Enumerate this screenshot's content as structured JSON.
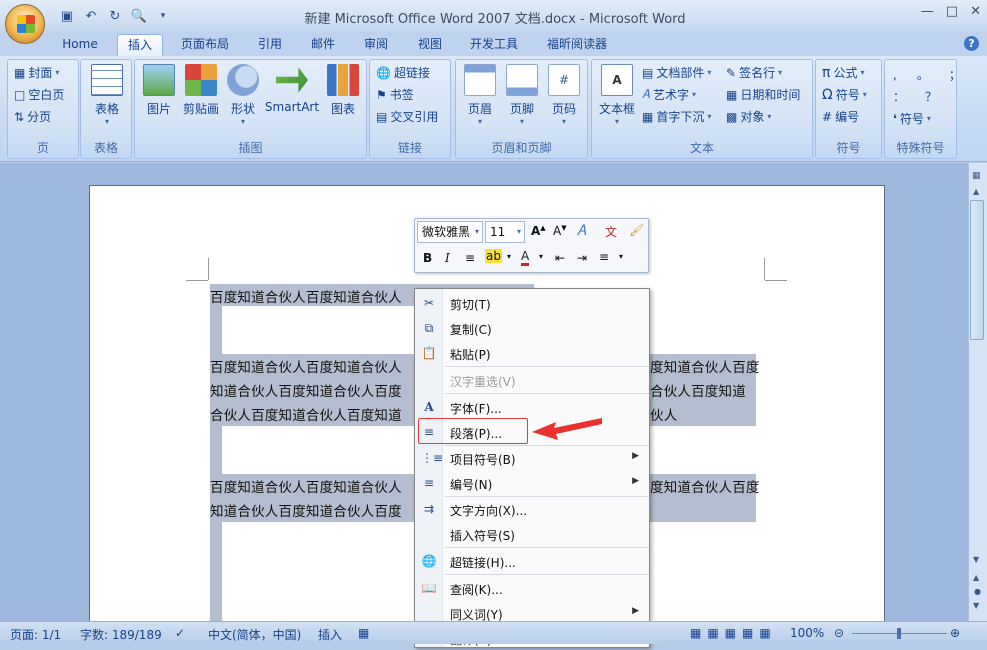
{
  "window": {
    "title": "新建 Microsoft Office Word 2007 文档.docx - Microsoft Word"
  },
  "tabs": [
    {
      "label": "Home",
      "active": false
    },
    {
      "label": "插入",
      "active": true
    },
    {
      "label": "页面布局",
      "active": false
    },
    {
      "label": "引用",
      "active": false
    },
    {
      "label": "邮件",
      "active": false
    },
    {
      "label": "审阅",
      "active": false
    },
    {
      "label": "视图",
      "active": false
    },
    {
      "label": "开发工具",
      "active": false
    },
    {
      "label": "福昕阅读器",
      "active": false
    }
  ],
  "ribbon": {
    "page_group": {
      "label": "页",
      "items": [
        "封面",
        "空白页",
        "分页"
      ]
    },
    "table_group": {
      "label": "表格",
      "button": "表格"
    },
    "illustration_group": {
      "label": "插图",
      "buttons": [
        "图片",
        "剪贴画",
        "形状",
        "SmartArt",
        "图表"
      ]
    },
    "link_group": {
      "label": "链接",
      "items": [
        "超链接",
        "书签",
        "交叉引用"
      ]
    },
    "header_group": {
      "label": "页眉和页脚",
      "buttons": [
        "页眉",
        "页脚",
        "页码"
      ]
    },
    "text_group": {
      "label": "文本",
      "big": "文本框",
      "items": [
        "文档部件",
        "艺术字",
        "首字下沉",
        "签名行",
        "日期和时间",
        "对象"
      ]
    },
    "symbol_group": {
      "label": "符号",
      "items": [
        "公式",
        "符号",
        "编号"
      ]
    },
    "special_group": {
      "label": "特殊符号",
      "chars": [
        ",",
        "。",
        "；",
        "：",
        "？"
      ],
      "item": "符号"
    }
  },
  "document": {
    "lines": [
      "百度知道合伙人百度知道合伙人",
      "百度知道合伙人百度知道合伙人",
      "知道合伙人百度知道合伙人百度",
      "合伙人百度知道合伙人百度知道",
      "百度知道合伙人百度知道合伙人",
      "知道合伙人百度知道合伙人百度"
    ],
    "right_fragments": [
      "度知道合伙人百度",
      "合伙人百度知道",
      "伙人",
      "度知道合伙人百度"
    ]
  },
  "mini_toolbar": {
    "font": "微软雅黑",
    "size": "11",
    "grow": "A",
    "shrink": "A",
    "bold": "B",
    "italic": "I",
    "font_color": "A"
  },
  "context_menu": {
    "items": [
      {
        "label": "剪切(T)",
        "icon": "scissors-icon"
      },
      {
        "label": "复制(C)",
        "icon": "copy-icon"
      },
      {
        "label": "粘贴(P)",
        "icon": "paste-icon"
      },
      {
        "label": "汉字重选(V)",
        "icon": "",
        "disabled": true
      },
      {
        "label": "字体(F)...",
        "icon": "font-icon"
      },
      {
        "label": "段落(P)...",
        "icon": "paragraph-icon"
      },
      {
        "label": "项目符号(B)",
        "icon": "bullets-icon",
        "submenu": true
      },
      {
        "label": "编号(N)",
        "icon": "numbering-icon",
        "submenu": true
      },
      {
        "label": "文字方向(X)...",
        "icon": "text-direction-icon"
      },
      {
        "label": "插入符号(S)",
        "icon": ""
      },
      {
        "label": "超链接(H)...",
        "icon": "hyperlink-icon"
      },
      {
        "label": "查阅(K)...",
        "icon": "research-icon"
      },
      {
        "label": "同义词(Y)",
        "icon": "",
        "submenu": true
      },
      {
        "label": "翻译(A)...",
        "icon": "translate-icon"
      }
    ]
  },
  "status": {
    "page": "页面: 1/1",
    "words": "字数: 189/189",
    "lang": "中文(简体，中国)",
    "mode": "插入",
    "zoom": "100%"
  }
}
